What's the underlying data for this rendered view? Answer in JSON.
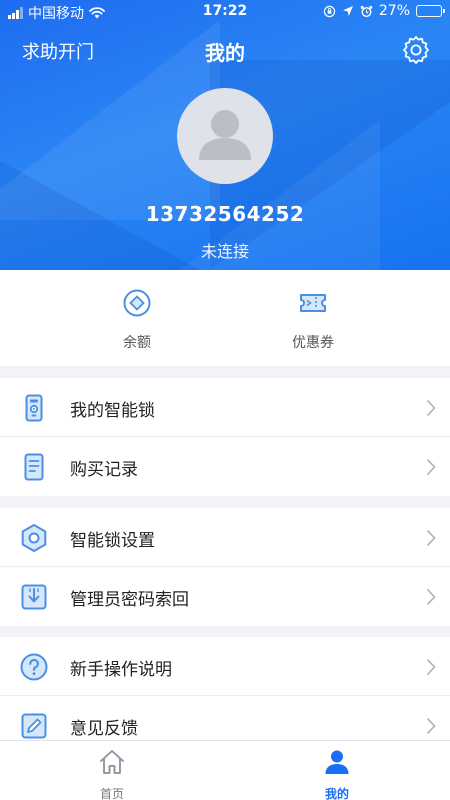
{
  "status_bar": {
    "carrier": "中国移动",
    "time": "17:22",
    "battery": "27%",
    "battery_level": 0.27
  },
  "nav": {
    "left_action": "求助开门",
    "title": "我的",
    "right_icon": "gear-icon"
  },
  "profile": {
    "phone": "13732564252",
    "connection_status": "未连接"
  },
  "quick_actions": [
    {
      "label": "余额",
      "icon": "balance-icon"
    },
    {
      "label": "优惠券",
      "icon": "coupon-icon"
    }
  ],
  "menu_sections": [
    [
      {
        "label": "我的智能锁",
        "icon": "smart-lock-icon"
      },
      {
        "label": "购买记录",
        "icon": "purchase-record-icon"
      }
    ],
    [
      {
        "label": "智能锁设置",
        "icon": "lock-settings-icon"
      },
      {
        "label": "管理员密码索回",
        "icon": "password-recovery-icon"
      }
    ],
    [
      {
        "label": "新手操作说明",
        "icon": "help-icon"
      },
      {
        "label": "意见反馈",
        "icon": "feedback-icon"
      }
    ]
  ],
  "tabbar": [
    {
      "label": "首页",
      "icon": "home-icon",
      "active": false
    },
    {
      "label": "我的",
      "icon": "user-icon",
      "active": true
    }
  ],
  "colors": {
    "primary": "#1a6ef5",
    "icon_blue": "#4a90e2",
    "background": "#f2f3f7"
  }
}
